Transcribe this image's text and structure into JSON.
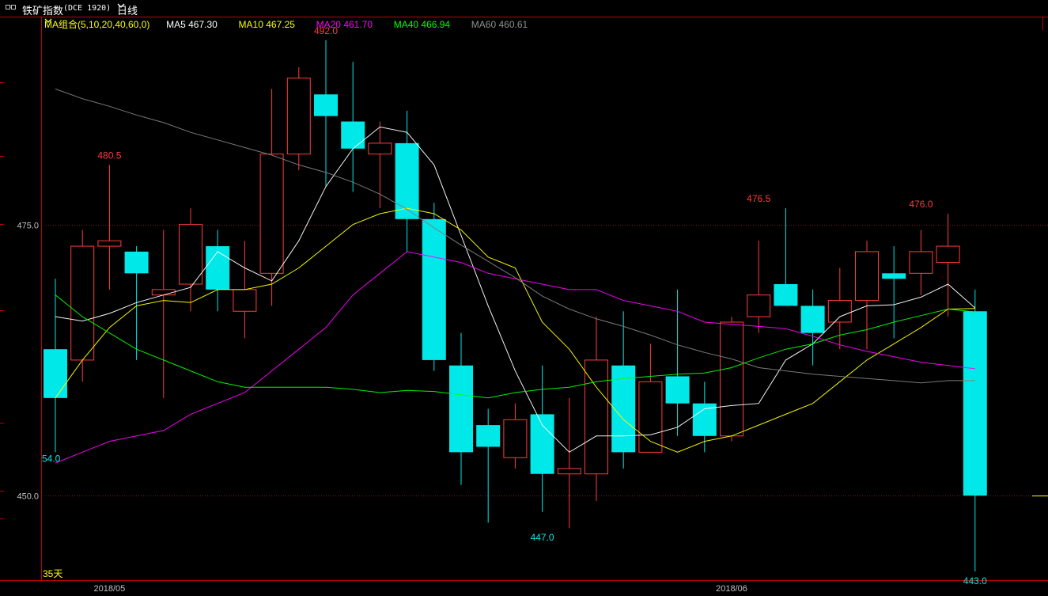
{
  "toolbar": {
    "instrument": "铁矿指数",
    "code": "(DCE 1920)",
    "period": "日线"
  },
  "legend": {
    "group_label": "MA组合(5,10,20,40,60,0)",
    "items": [
      {
        "name": "MA5",
        "value": "467.30",
        "color": "#ffffff"
      },
      {
        "name": "MA10",
        "value": "467.25",
        "color": "#ffff00"
      },
      {
        "name": "MA20",
        "value": "461.70",
        "color": "#ff00ff"
      },
      {
        "name": "MA40",
        "value": "466.94",
        "color": "#00ff00"
      },
      {
        "name": "MA60",
        "value": "460.61",
        "color": "#808080"
      }
    ]
  },
  "colors": {
    "up": "#ff3c3c",
    "down": "#00e8e8",
    "grid": "#7a1a1a",
    "axis_text": "#c0c0c0",
    "border": "#c00000"
  },
  "bars_count_label": "35天",
  "chart_data": {
    "type": "candlestick",
    "yticks": [
      450.0,
      475.0
    ],
    "ylim": [
      442.2,
      494.1
    ],
    "xlabels": [
      {
        "index": 2,
        "label": "2018/05"
      },
      {
        "index": 25,
        "label": "2018/06"
      }
    ],
    "annotations": [
      {
        "index": 2,
        "value": 480.5,
        "label": "480.5",
        "kind": "high"
      },
      {
        "index": 10,
        "value": 492.0,
        "label": "492.0",
        "kind": "high"
      },
      {
        "index": 18,
        "value": 447.0,
        "label": "447.0",
        "kind": "low"
      },
      {
        "index": 26,
        "value": 476.5,
        "label": "476.5",
        "kind": "high"
      },
      {
        "index": 32,
        "value": 476.0,
        "label": "476.0",
        "kind": "high"
      },
      {
        "index": 34,
        "value": 443.0,
        "label": "443.0",
        "kind": "low"
      },
      {
        "index": 0,
        "value": 454.0,
        "label": "54.0",
        "kind": "low"
      }
    ],
    "candles": [
      {
        "o": 463.5,
        "h": 470.0,
        "l": 454.0,
        "c": 459.0
      },
      {
        "o": 462.5,
        "h": 474.5,
        "l": 460.5,
        "c": 473.0
      },
      {
        "o": 473.0,
        "h": 480.5,
        "l": 469.0,
        "c": 473.5
      },
      {
        "o": 472.5,
        "h": 473.0,
        "l": 462.5,
        "c": 470.5
      },
      {
        "o": 468.5,
        "h": 474.5,
        "l": 459.0,
        "c": 469.0
      },
      {
        "o": 469.5,
        "h": 476.5,
        "l": 467.0,
        "c": 475.0
      },
      {
        "o": 473.0,
        "h": 474.5,
        "l": 467.0,
        "c": 469.0
      },
      {
        "o": 467.0,
        "h": 473.5,
        "l": 464.5,
        "c": 469.0
      },
      {
        "o": 470.5,
        "h": 487.5,
        "l": 467.5,
        "c": 481.5
      },
      {
        "o": 481.5,
        "h": 489.5,
        "l": 480.0,
        "c": 488.5
      },
      {
        "o": 487.0,
        "h": 492.0,
        "l": 478.5,
        "c": 485.0
      },
      {
        "o": 484.5,
        "h": 490.0,
        "l": 478.0,
        "c": 482.0
      },
      {
        "o": 481.5,
        "h": 484.5,
        "l": 476.5,
        "c": 482.5
      },
      {
        "o": 482.5,
        "h": 485.5,
        "l": 472.5,
        "c": 475.5
      },
      {
        "o": 475.5,
        "h": 477.0,
        "l": 461.5,
        "c": 462.5
      },
      {
        "o": 462.0,
        "h": 465.0,
        "l": 451.0,
        "c": 454.0
      },
      {
        "o": 456.5,
        "h": 458.0,
        "l": 447.5,
        "c": 454.5
      },
      {
        "o": 453.5,
        "h": 458.5,
        "l": 452.5,
        "c": 457.0
      },
      {
        "o": 457.5,
        "h": 462.0,
        "l": 448.5,
        "c": 452.0
      },
      {
        "o": 452.0,
        "h": 459.0,
        "l": 447.0,
        "c": 452.5
      },
      {
        "o": 452.0,
        "h": 466.5,
        "l": 449.5,
        "c": 462.5
      },
      {
        "o": 462.0,
        "h": 467.0,
        "l": 452.5,
        "c": 454.0
      },
      {
        "o": 454.0,
        "h": 464.0,
        "l": 454.0,
        "c": 460.5
      },
      {
        "o": 461.0,
        "h": 469.0,
        "l": 455.5,
        "c": 458.5
      },
      {
        "o": 458.5,
        "h": 460.5,
        "l": 454.0,
        "c": 455.5
      },
      {
        "o": 455.5,
        "h": 466.5,
        "l": 455.0,
        "c": 466.0
      },
      {
        "o": 466.5,
        "h": 473.5,
        "l": 465.0,
        "c": 468.5
      },
      {
        "o": 469.5,
        "h": 476.5,
        "l": 467.5,
        "c": 467.5
      },
      {
        "o": 467.5,
        "h": 469.0,
        "l": 462.0,
        "c": 465.0
      },
      {
        "o": 466.0,
        "h": 471.0,
        "l": 463.5,
        "c": 468.0
      },
      {
        "o": 468.0,
        "h": 473.5,
        "l": 463.5,
        "c": 472.5
      },
      {
        "o": 470.5,
        "h": 473.0,
        "l": 464.5,
        "c": 470.0
      },
      {
        "o": 470.5,
        "h": 474.5,
        "l": 468.5,
        "c": 472.5
      },
      {
        "o": 471.5,
        "h": 476.0,
        "l": 466.5,
        "c": 473.0
      },
      {
        "o": 467.0,
        "h": 469.0,
        "l": 443.0,
        "c": 450.0
      }
    ],
    "ma": {
      "MA5": [
        466.5,
        466.1,
        466.8,
        467.8,
        468.5,
        469.2,
        472.5,
        471.0,
        469.8,
        473.5,
        478.5,
        482.0,
        484.0,
        483.5,
        480.5,
        474.0,
        467.5,
        461.5,
        456.5,
        454.0,
        455.5,
        455.5,
        455.6,
        456.3,
        458.0,
        458.3,
        458.5,
        462.5,
        464.0,
        466.5,
        467.5,
        467.6,
        468.3,
        469.5,
        467.3
      ],
      "MA10": [
        459.0,
        462.5,
        465.5,
        467.5,
        468.0,
        467.8,
        469.0,
        469.0,
        469.5,
        471.0,
        473.0,
        475.0,
        476.0,
        476.5,
        476.0,
        474.5,
        472.0,
        471.0,
        466.0,
        463.5,
        460.0,
        457.0,
        455.0,
        454.0,
        455.0,
        455.5,
        456.5,
        457.5,
        458.5,
        460.5,
        462.5,
        464.0,
        465.5,
        467.2,
        467.25
      ],
      "MA20": [
        453.0,
        454.0,
        455.0,
        455.5,
        456.0,
        457.5,
        458.5,
        459.5,
        461.5,
        463.5,
        465.5,
        468.5,
        470.5,
        472.5,
        472.0,
        471.5,
        470.5,
        470.0,
        469.5,
        469.0,
        469.0,
        468.0,
        467.5,
        467.0,
        466.0,
        465.8,
        465.6,
        465.4,
        464.7,
        463.9,
        463.3,
        462.8,
        462.3,
        462.0,
        461.7
      ],
      "MA40": [
        468.5,
        466.5,
        465.0,
        463.5,
        462.5,
        461.5,
        460.5,
        460.0,
        460.0,
        460.0,
        460.0,
        459.8,
        459.5,
        459.7,
        459.6,
        459.3,
        459.0,
        459.5,
        459.8,
        460.0,
        460.5,
        460.8,
        461.0,
        461.2,
        461.3,
        461.8,
        462.7,
        463.5,
        464.0,
        464.8,
        465.3,
        466.0,
        466.6,
        467.2,
        466.94
      ],
      "MA60": [
        487.5,
        486.6,
        485.9,
        485.1,
        484.4,
        483.5,
        482.8,
        482.1,
        481.4,
        480.5,
        479.8,
        478.9,
        477.8,
        476.4,
        474.7,
        473.1,
        471.6,
        470.1,
        468.4,
        467.2,
        466.3,
        465.6,
        464.8,
        463.9,
        463.2,
        462.6,
        461.8,
        461.5,
        461.2,
        461.0,
        460.8,
        460.6,
        460.4,
        460.6,
        460.61
      ]
    }
  }
}
